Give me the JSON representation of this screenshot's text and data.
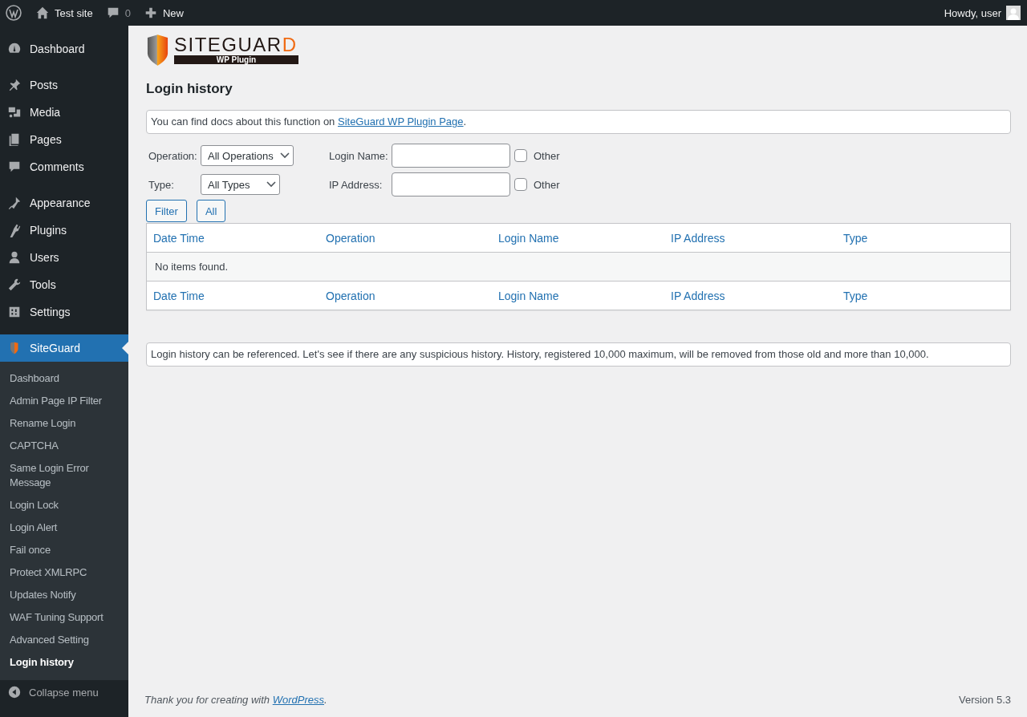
{
  "admin_bar": {
    "site": "Test site",
    "comments": "0",
    "new": "New",
    "greeting": "Howdy, user"
  },
  "sidebar": {
    "groups": [
      [
        {
          "label": "Dashboard",
          "selected": false
        }
      ],
      [
        {
          "label": "Posts",
          "selected": false
        },
        {
          "label": "Media",
          "selected": false
        },
        {
          "label": "Pages",
          "selected": false
        },
        {
          "label": "Comments",
          "selected": false
        }
      ],
      [
        {
          "label": "Appearance",
          "selected": false
        },
        {
          "label": "Plugins",
          "selected": false
        },
        {
          "label": "Users",
          "selected": false
        },
        {
          "label": "Tools",
          "selected": false
        },
        {
          "label": "Settings",
          "selected": false
        }
      ],
      [
        {
          "label": "SiteGuard",
          "selected": true
        }
      ]
    ],
    "submenu": [
      {
        "label": "Dashboard",
        "selected": false
      },
      {
        "label": "Admin Page IP Filter",
        "selected": false
      },
      {
        "label": "Rename Login",
        "selected": false
      },
      {
        "label": "CAPTCHA",
        "selected": false
      },
      {
        "label": "Same Login Error Message",
        "selected": false
      },
      {
        "label": "Login Lock",
        "selected": false
      },
      {
        "label": "Login Alert",
        "selected": false
      },
      {
        "label": "Fail once",
        "selected": false
      },
      {
        "label": "Protect XMLRPC",
        "selected": false
      },
      {
        "label": "Updates Notify",
        "selected": false
      },
      {
        "label": "WAF Tuning Support",
        "selected": false
      },
      {
        "label": "Advanced Setting",
        "selected": false
      },
      {
        "label": "Login history",
        "selected": true
      }
    ],
    "collapse": "Collapse menu"
  },
  "logo": {
    "word": "SITEGUARD",
    "tagline": "WP Plugin"
  },
  "title": "Login history",
  "docs_notice": {
    "text": "You can find docs about this function on ",
    "link": "SiteGuard WP Plugin Page",
    "end": "."
  },
  "filters": {
    "operation": {
      "label": "Operation:",
      "value": "All Operations"
    },
    "type": {
      "label": "Type:",
      "value": "All Types"
    },
    "login_name": {
      "label": "Login Name:",
      "other": "Other",
      "checked": false
    },
    "ip_address": {
      "label": "IP Address:",
      "other": "Other",
      "checked": false
    }
  },
  "buttons": [
    "Filter",
    "All"
  ],
  "table": {
    "columns": [
      "Date Time",
      "Operation",
      "Login Name",
      "IP Address",
      "Type"
    ],
    "empty": "No items found.",
    "footer_columns": [
      "Date Time",
      "Operation",
      "Login Name",
      "IP Address",
      "Type"
    ]
  },
  "info_notice": "Login history can be referenced. Let's see if there are any suspicious history. History, registered 10,000 maximum, will be removed from those old and more than 10,000.",
  "footer": {
    "text": "Thank you for creating with ",
    "link": "WordPress",
    "end": ".",
    "version": "Version 5.3"
  }
}
